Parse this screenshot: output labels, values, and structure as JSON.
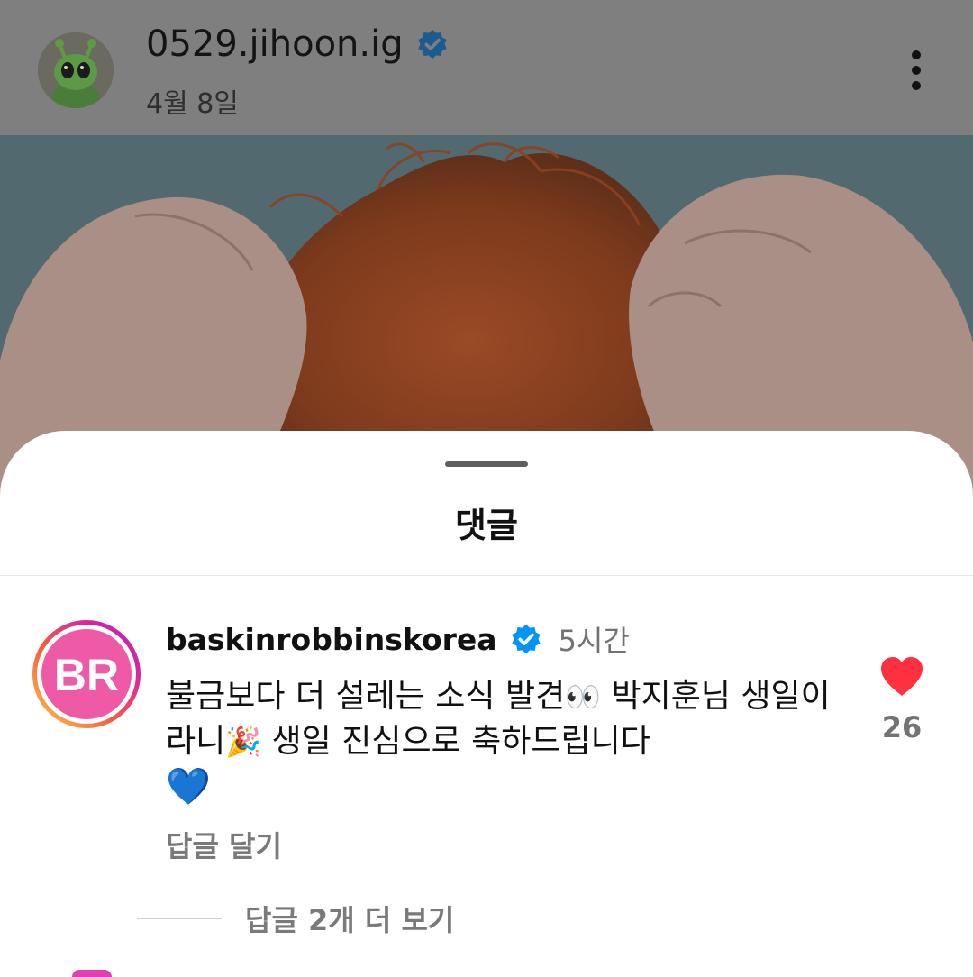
{
  "post": {
    "username": "0529.jihoon.ig",
    "date": "4월 8일"
  },
  "sheet": {
    "title": "댓글"
  },
  "comment": {
    "username": "baskinrobbinskorea",
    "time": "5시간",
    "avatar_text": "BR",
    "text_part1": "불금보다 더 설레는 소식 발견",
    "emoji_eyes": "👀",
    "text_part2": " 박지훈님 생일이라니",
    "emoji_party": "🎉",
    "text_part3": " 생일 진심으로 축하드립니다",
    "emoji_heart": "💙",
    "likes": "26",
    "reply_label": "답글 달기",
    "view_replies_label": "답글 2개 더 보기"
  },
  "colors": {
    "verified": "#0095f6",
    "like": "#ff3040",
    "brand_pink": "#e8509c"
  }
}
